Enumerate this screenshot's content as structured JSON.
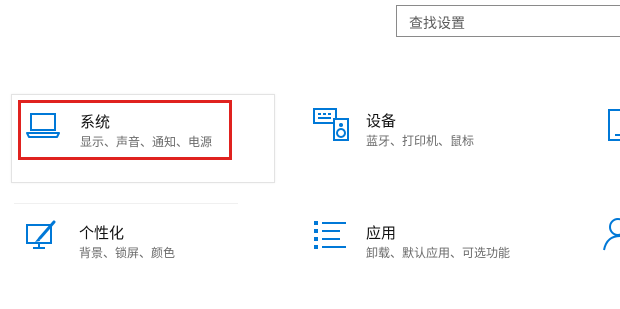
{
  "search": {
    "placeholder": "查找设置"
  },
  "colors": {
    "accent": "#0078d7",
    "annotation": "#e0221f"
  },
  "tiles": [
    {
      "id": "system",
      "icon": "laptop-icon",
      "title": "系统",
      "desc": "显示、声音、通知、电源"
    },
    {
      "id": "devices",
      "icon": "keyboard-speaker-icon",
      "title": "设备",
      "desc": "蓝牙、打印机、鼠标"
    },
    {
      "id": "personalization",
      "icon": "paint-icon",
      "title": "个性化",
      "desc": "背景、锁屏、颜色"
    },
    {
      "id": "apps",
      "icon": "list-icon",
      "title": "应用",
      "desc": "卸载、默认应用、可选功能"
    }
  ]
}
